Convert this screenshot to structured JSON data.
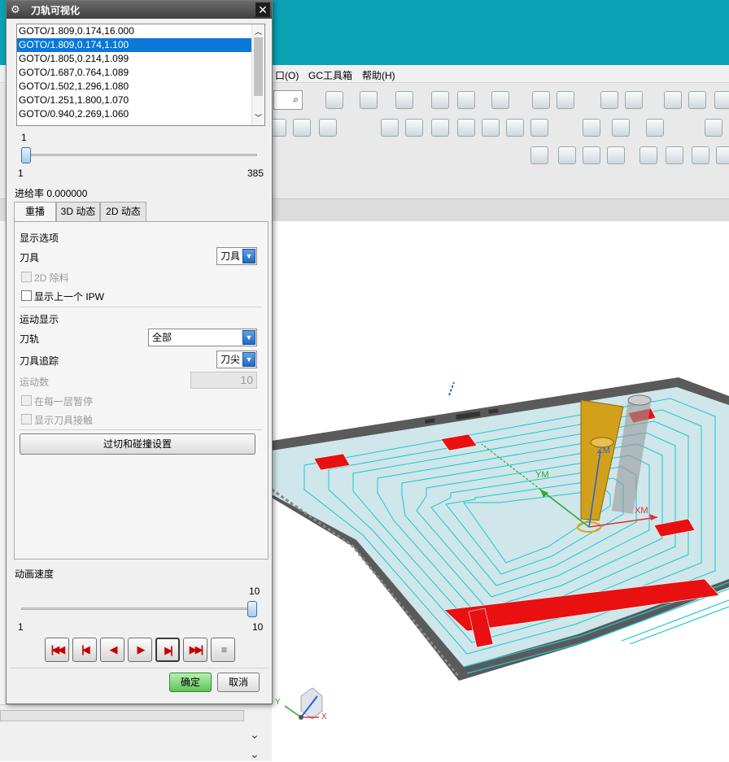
{
  "app": {
    "menu": [
      "口(O)",
      "GC工具箱",
      "帮助(H)"
    ]
  },
  "dialog": {
    "title": "刀轨可视化",
    "list_items": [
      "GOTO/1.809,0.174,16.000",
      "GOTO/1.809,0.174,1.100",
      "GOTO/1.805,0.214,1.099",
      "GOTO/1.687,0.764,1.089",
      "GOTO/1.502,1.296,1.080",
      "GOTO/1.251,1.800,1.070",
      "GOTO/0.940,2.269,1.060"
    ],
    "selected_index": 1,
    "position_slider": {
      "value": "1",
      "min": "1",
      "max": "385",
      "fraction": 0.0
    },
    "feed_rate": "进给率 0.000000",
    "tabs": [
      "重播",
      "3D 动态",
      "2D 动态"
    ],
    "display_options": {
      "header": "显示选项",
      "tool_label": "刀具",
      "tool_value": "刀具",
      "remove_2d": "2D 除料",
      "show_prev_ipw": "显示上一个 IPW"
    },
    "motion_display": {
      "header": "运动显示",
      "path_label": "刀轨",
      "path_value": "全部",
      "trace_label": "刀具追踪",
      "trace_value": "刀尖",
      "motion_count_label": "运动数",
      "motion_count_value": "10",
      "pause_each_layer": "在每一层暂停",
      "show_tool_contact": "显示刀具接触",
      "gouge_button": "过切和碰撞设置"
    },
    "anim_speed": {
      "label": "动画速度",
      "value": "10",
      "min": "1",
      "max": "10",
      "fraction": 1.0
    },
    "playback": {
      "buttons": [
        "to-start",
        "step-back",
        "play-reverse",
        "play-forward",
        "step-forward",
        "to-end",
        "stop"
      ],
      "glyphs": [
        "|◀◀",
        "|◀",
        "◀",
        "▶",
        "▶|",
        "▶▶|",
        "■"
      ]
    },
    "ok_label": "确定",
    "cancel_label": "取消"
  },
  "viewport": {
    "axis_labels": {
      "zm": "ZM",
      "ym": "YM",
      "xm": "XM"
    },
    "triad_labels": {
      "x": "X",
      "y": "Y"
    },
    "colors": {
      "stock": "#cfe6ea",
      "toolpath": "#19c8d6",
      "pocket": "#e81010",
      "tool": "#d2a01a",
      "frame": "#555555"
    }
  }
}
